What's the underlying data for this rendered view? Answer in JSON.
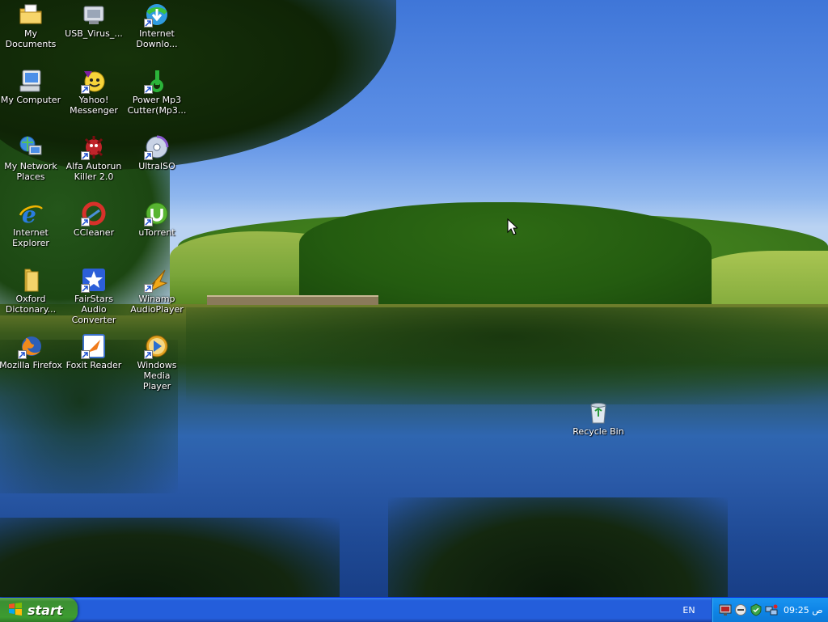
{
  "desktop": {
    "icons": [
      {
        "label": "My Documents",
        "icon": "my-documents-icon",
        "shortcut": false
      },
      {
        "label": "USB_Virus_...",
        "icon": "usb-virus-scan-icon",
        "shortcut": false
      },
      {
        "label": "Internet\nDownlo...",
        "icon": "internet-download-manager-icon",
        "shortcut": true
      },
      {
        "label": "My Computer",
        "icon": "my-computer-icon",
        "shortcut": false
      },
      {
        "label": "Yahoo!\nMessenger",
        "icon": "yahoo-messenger-icon",
        "shortcut": true
      },
      {
        "label": "Power Mp3\nCutter(Mp3...",
        "icon": "power-mp3-cutter-icon",
        "shortcut": true
      },
      {
        "label": "My Network\nPlaces",
        "icon": "my-network-places-icon",
        "shortcut": false
      },
      {
        "label": "Alfa Autorun\nKiller 2.0",
        "icon": "alfa-autorun-killer-icon",
        "shortcut": true
      },
      {
        "label": "UltraISO",
        "icon": "ultraiso-icon",
        "shortcut": true
      },
      {
        "label": "Internet\nExplorer",
        "icon": "internet-explorer-icon",
        "shortcut": false
      },
      {
        "label": "CCleaner",
        "icon": "ccleaner-icon",
        "shortcut": true
      },
      {
        "label": "uTorrent",
        "icon": "utorrent-icon",
        "shortcut": true
      },
      {
        "label": "Oxford\nDictonary...",
        "icon": "folder-icon",
        "shortcut": false
      },
      {
        "label": "FairStars Audio\nConverter",
        "icon": "fairstars-audio-converter-icon",
        "shortcut": true
      },
      {
        "label": "Winamp\nAudioPlayer",
        "icon": "winamp-icon",
        "shortcut": true
      },
      {
        "label": "Mozilla Firefox",
        "icon": "firefox-icon",
        "shortcut": true
      },
      {
        "label": "Foxit Reader",
        "icon": "foxit-reader-icon",
        "shortcut": true
      },
      {
        "label": "Windows Media\nPlayer",
        "icon": "windows-media-player-icon",
        "shortcut": true
      },
      {
        "label": "Recycle Bin",
        "icon": "recycle-bin-icon",
        "shortcut": false
      }
    ]
  },
  "taskbar": {
    "start_label": "start",
    "language": "EN",
    "tray_icons": [
      "monitor-icon",
      "messenger-status-icon",
      "shield-icon",
      "network-icon"
    ],
    "clock": "09:25 ص"
  },
  "colors": {
    "taskbar_blue": "#245edb",
    "start_green": "#3c9c31",
    "tray_blue": "#0f86e8"
  }
}
